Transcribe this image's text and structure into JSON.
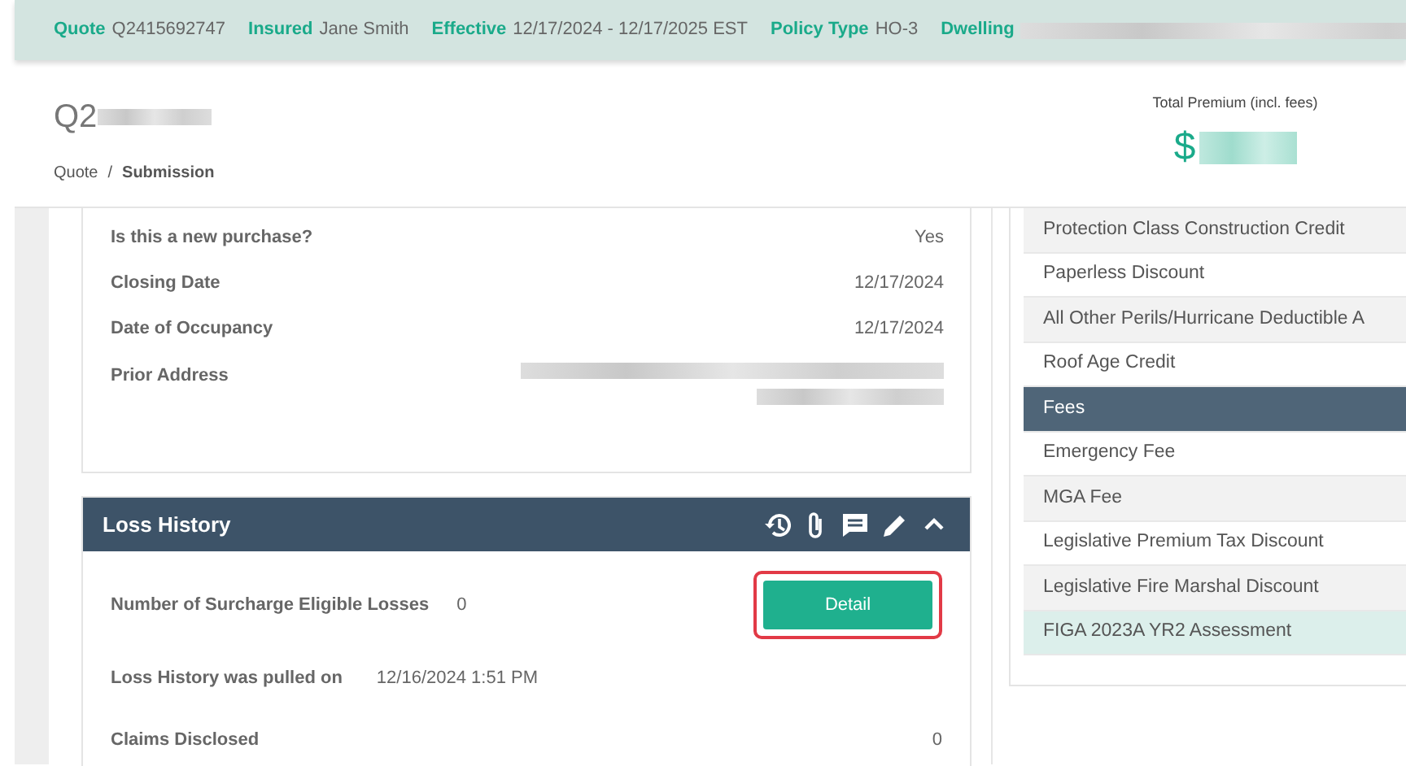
{
  "top_bar": {
    "items": [
      {
        "label": "Quote",
        "value": "Q2415692747"
      },
      {
        "label": "Insured",
        "value": "Jane Smith"
      },
      {
        "label": "Effective",
        "value": "12/17/2024 - 12/17/2025 EST"
      },
      {
        "label": "Policy Type",
        "value": "HO-3"
      },
      {
        "label": "Dwelling"
      }
    ]
  },
  "header": {
    "title_prefix": "Q2",
    "breadcrumb": [
      {
        "label": "Quote",
        "current": false
      },
      {
        "label": "Submission",
        "current": true
      }
    ],
    "breadcrumb_separator": "/",
    "premium": {
      "label": "Total Premium (incl. fees)",
      "currency": "$"
    }
  },
  "details": {
    "rows": [
      {
        "label": "Is this a new purchase?",
        "value": "Yes"
      },
      {
        "label": "Closing Date",
        "value": "12/17/2024"
      },
      {
        "label": "Date of Occupancy",
        "value": "12/17/2024"
      },
      {
        "label": "Prior Address"
      }
    ]
  },
  "loss_history": {
    "title": "Loss History",
    "button": "Detail",
    "button_highlighted": true,
    "rows": [
      {
        "label": "Number of Surcharge Eligible Losses",
        "value": "0",
        "kind": "inline"
      },
      {
        "label": "Loss History was pulled on",
        "value": "12/16/2024 1:51 PM",
        "kind": "inline"
      },
      {
        "label": "Claims Disclosed",
        "value": "0",
        "kind": "end"
      }
    ]
  },
  "premium_table": {
    "rows": [
      {
        "label": "Protection Class Construction Credit",
        "kind": "item",
        "highlighted": false
      },
      {
        "label": "Paperless Discount",
        "kind": "item",
        "highlighted": false
      },
      {
        "label": "All Other Perils/Hurricane Deductible A",
        "kind": "item",
        "highlighted": false
      },
      {
        "label": "Roof Age Credit",
        "kind": "item",
        "highlighted": false
      },
      {
        "label": "Fees",
        "kind": "section",
        "highlighted": false
      },
      {
        "label": "Emergency Fee",
        "kind": "item",
        "highlighted": false
      },
      {
        "label": "MGA Fee",
        "kind": "item",
        "highlighted": false
      },
      {
        "label": "Legislative Premium Tax Discount",
        "kind": "item",
        "highlighted": false
      },
      {
        "label": "Legislative Fire Marshal Discount",
        "kind": "item",
        "highlighted": false
      },
      {
        "label": "FIGA 2023A YR2 Assessment",
        "kind": "item",
        "highlighted": true
      }
    ]
  }
}
